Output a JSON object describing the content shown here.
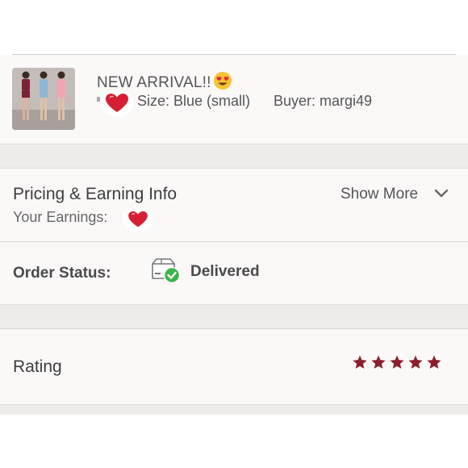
{
  "item": {
    "title": "NEW ARRIVAL!!",
    "title_emoji": "heart-eyes-emoji",
    "thumbnail": "three-models-rompers-photo",
    "size": "Size: Blue (small)",
    "buyer": "Buyer: margi49"
  },
  "pricing": {
    "title": "Pricing & Earning Info",
    "show_more": "Show More",
    "earnings_label": "Your Earnings:",
    "earnings_cover": "red-heart-sticker"
  },
  "order_status": {
    "label": "Order Status:",
    "value": "Delivered",
    "icon": "delivered-box-check-icon"
  },
  "rating": {
    "label": "Rating",
    "stars": 5,
    "max_stars": 5
  },
  "colors": {
    "star": "#8b1f2a",
    "check": "#3bb54a",
    "heart": "#d71f33",
    "row_bg": "#fbf8f8",
    "band_bg": "#efebe8"
  }
}
